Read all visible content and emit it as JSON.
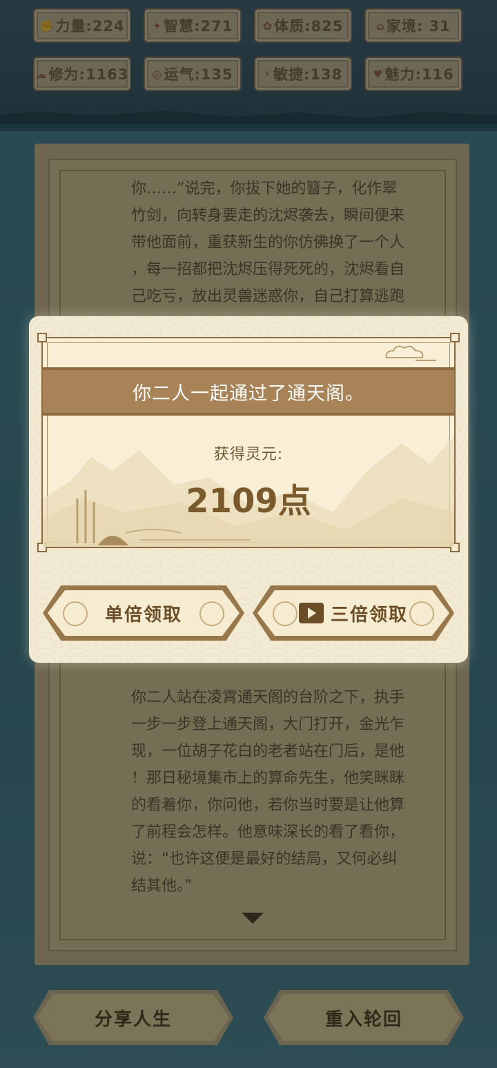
{
  "stats": [
    {
      "icon": "fist-icon",
      "glyph": "✊",
      "label": "力量:224"
    },
    {
      "icon": "brain-icon",
      "glyph": "✦",
      "label": "智慧:271"
    },
    {
      "icon": "body-icon",
      "glyph": "✿",
      "label": "体质:825"
    },
    {
      "icon": "house-icon",
      "glyph": "⌂",
      "label": "家境: 31"
    },
    {
      "icon": "cloud-icon",
      "glyph": "☁",
      "label": "修为:1163"
    },
    {
      "icon": "luck-icon",
      "glyph": "◎",
      "label": "运气:135"
    },
    {
      "icon": "lightning-icon",
      "glyph": "⚡",
      "label": "敏捷:138"
    },
    {
      "icon": "heart-icon",
      "glyph": "♥",
      "label": "魅力:116"
    }
  ],
  "story_top": [
    "你……”说完，你拔下她的簪子，化作翠",
    "竹剑，向转身要走的沈烬袭去，瞬间便来",
    "带他面前，重获新生的你仿佛换了一个人",
    "，每一招都把沈烬压得死死的，沈烬看自",
    "己吃亏，放出灵兽迷惑你，自己打算逃跑"
  ],
  "story_bottom": [
    "你二人站在凌霄通天阁的台阶之下，执手",
    "一步一步登上通天阁，大门打开，金光乍",
    "现，一位胡子花白的老者站在门后，是他",
    "！那日秘境集市上的算命先生，他笑眯眯",
    "的看着你，你问他，若你当时要是让他算",
    "了前程会怎样。他意味深长的看了看你，",
    "说：“也许这便是最好的结局，又何必纠",
    "结其他。”"
  ],
  "bottom_buttons": {
    "share": "分享人生",
    "rebirth": "重入轮回"
  },
  "modal": {
    "title": "你二人一起通过了通天阁。",
    "reward_label": "获得灵元:",
    "reward_value": "2109点",
    "single_claim": "单倍领取",
    "triple_claim": "三倍领取"
  },
  "colors": {
    "modal_bg": "#f2ead2",
    "title_band": "#a78357",
    "accent_text": "#7a5a2c"
  }
}
